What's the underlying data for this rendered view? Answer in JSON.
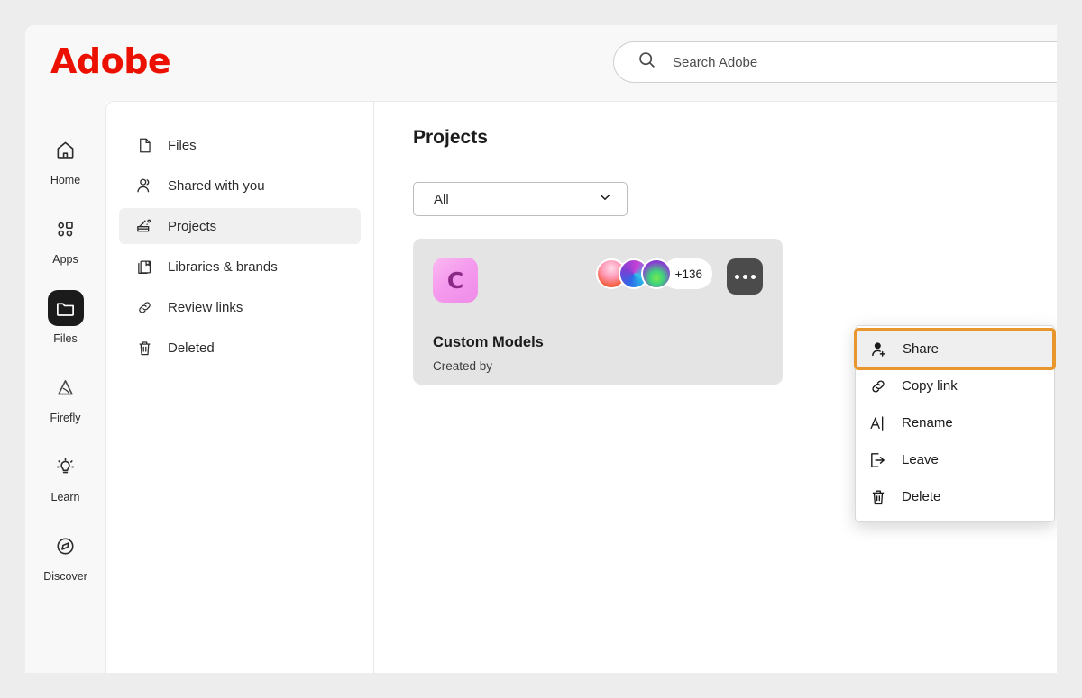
{
  "brand": {
    "logo_text": "Adobe",
    "logo_color": "#EB1000"
  },
  "search": {
    "placeholder": "Search Adobe",
    "icon": "search-icon"
  },
  "rail": {
    "items": [
      {
        "label": "Home",
        "icon": "home-icon",
        "active": false
      },
      {
        "label": "Apps",
        "icon": "apps-grid-icon",
        "active": false
      },
      {
        "label": "Files",
        "icon": "folder-icon",
        "active": true
      },
      {
        "label": "Firefly",
        "icon": "firefly-icon",
        "active": false
      },
      {
        "label": "Learn",
        "icon": "lightbulb-icon",
        "active": false
      },
      {
        "label": "Discover",
        "icon": "compass-icon",
        "active": false
      }
    ]
  },
  "nav": {
    "items": [
      {
        "label": "Files",
        "icon": "document-icon",
        "active": false
      },
      {
        "label": "Shared with you",
        "icon": "people-icon",
        "active": false
      },
      {
        "label": "Projects",
        "icon": "projects-icon",
        "active": true
      },
      {
        "label": "Libraries & brands",
        "icon": "libraries-icon",
        "active": false
      },
      {
        "label": "Review links",
        "icon": "link-icon",
        "active": false
      },
      {
        "label": "Deleted",
        "icon": "trash-icon",
        "active": false
      }
    ]
  },
  "main": {
    "title": "Projects",
    "filter": {
      "value": "All",
      "chevron": "chevron-down-icon"
    },
    "project": {
      "initial": "C",
      "name": "Custom Models",
      "created_by": "Created by",
      "collaborators_overflow": "+136",
      "avatar_count": 3,
      "more_button": "ellipsis-icon"
    }
  },
  "context_menu": {
    "highlight_color": "#E8962E",
    "items": [
      {
        "label": "Share",
        "icon": "person-add-icon",
        "highlighted": true
      },
      {
        "label": "Copy link",
        "icon": "link-icon",
        "highlighted": false
      },
      {
        "label": "Rename",
        "icon": "text-cursor-icon",
        "highlighted": false
      },
      {
        "label": "Leave",
        "icon": "exit-icon",
        "highlighted": false
      },
      {
        "label": "Delete",
        "icon": "trash-icon",
        "highlighted": false
      }
    ]
  }
}
